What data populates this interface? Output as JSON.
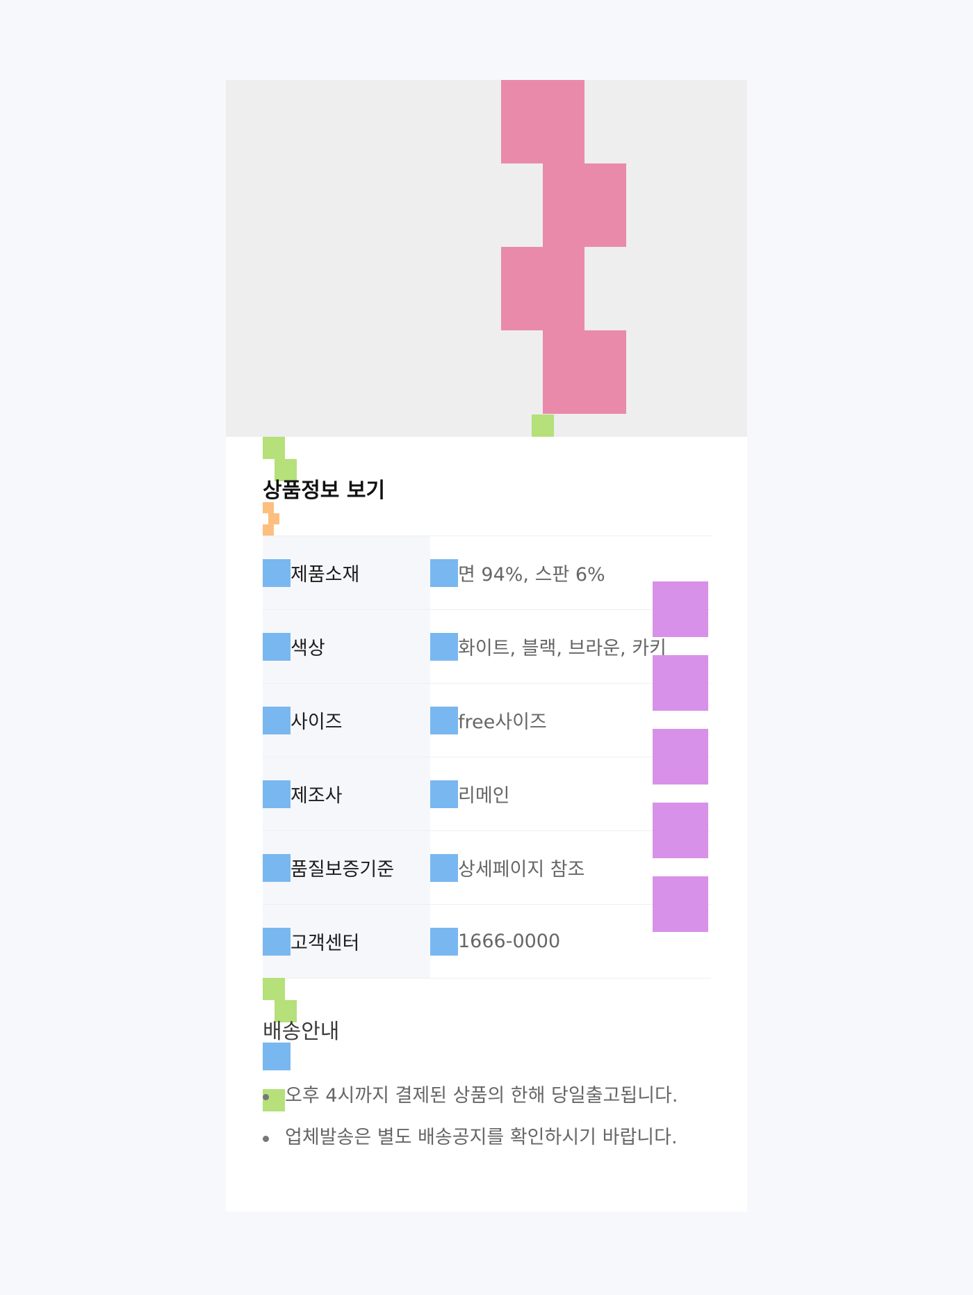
{
  "product_info": {
    "title": "상품정보 보기",
    "rows": [
      {
        "label": "제품소재",
        "value": "면 94%, 스판 6%"
      },
      {
        "label": "색상",
        "value": "화이트, 블랙, 브라운, 카키"
      },
      {
        "label": "사이즈",
        "value": "free사이즈"
      },
      {
        "label": "제조사",
        "value": "리메인"
      },
      {
        "label": "품질보증기준",
        "value": "상세페이지 참조"
      },
      {
        "label": "고객센터",
        "value": "1666-0000"
      }
    ]
  },
  "shipping": {
    "title": "배송안내",
    "items": [
      "오후 4시까지 결제된 상품의 한해 당일출고됩니다.",
      "업체발송은 별도 배송공지를 확인하시기 바랍니다."
    ]
  },
  "colors": {
    "page_background": "#f7f8fb",
    "card_background": "#ffffff",
    "hero_background": "#eeeeee",
    "pink_block": "#e98aab",
    "green_block": "#b5e07a",
    "orange_block": "#fdbf7f",
    "blue_block": "#79b7f0",
    "purple_block": "#d891e8"
  }
}
